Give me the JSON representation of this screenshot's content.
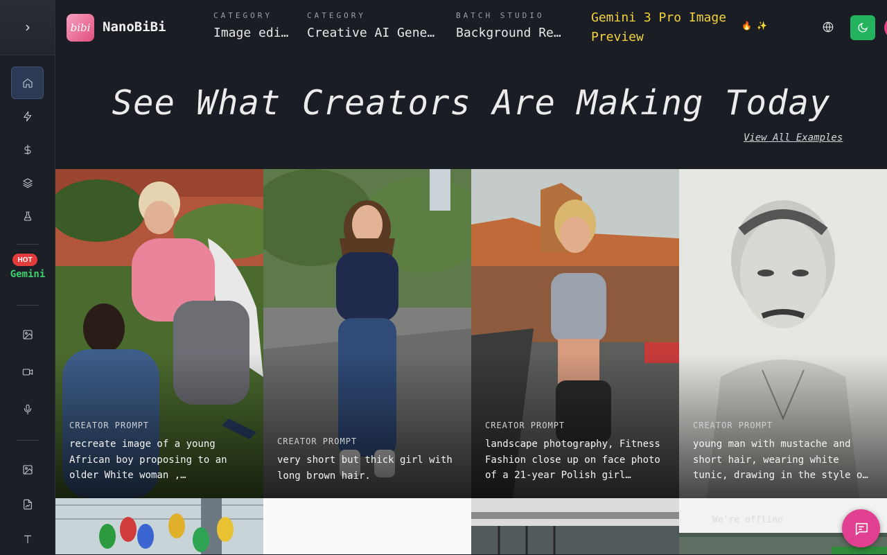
{
  "app": {
    "brand": "NanoBiBi",
    "logo_text": "bibi"
  },
  "sidebar": {
    "items": [
      {
        "icon": "home-icon"
      },
      {
        "icon": "lightning-icon"
      },
      {
        "icon": "dollar-icon"
      },
      {
        "icon": "layers-icon"
      },
      {
        "icon": "flask-icon"
      },
      {
        "icon": "image-icon"
      },
      {
        "icon": "video-icon"
      },
      {
        "icon": "microphone-icon"
      },
      {
        "icon": "image-edit-icon"
      },
      {
        "icon": "file-image-icon"
      },
      {
        "icon": "text-icon"
      }
    ],
    "hot_badge": "HOT",
    "gemini_label": "Gemini"
  },
  "header": {
    "nav": [
      {
        "caption": "CATEGORY",
        "value": "Image editing"
      },
      {
        "caption": "CATEGORY",
        "value": "Creative AI Generation"
      },
      {
        "caption": "BATCH STUDIO",
        "value": "Background Remover"
      }
    ],
    "model_name": "Gemini 3 Pro Image Preview",
    "model_emoji": "🔥 ✨"
  },
  "hero": {
    "title": "See What Creators Are Making Today",
    "view_all": "View All Examples"
  },
  "gallery": {
    "caption": "CREATOR PROMPT",
    "cards": [
      {
        "prompt": "recreate image of a young African boy proposing to an older White woman ,…"
      },
      {
        "prompt": "very short but thick girl with long brown hair."
      },
      {
        "prompt": "landscape photography, Fitness Fashion close up on face photo of a 21-year Polish girl…"
      },
      {
        "prompt": "young man with mustache and short hair, wearing white tunic, drawing in the style o…"
      }
    ]
  },
  "chat": {
    "offline_text": "We're offline"
  },
  "colors": {
    "accent_green": "#23b35e",
    "gemini_yellow": "#f3d23c",
    "hot_red": "#e23b3b",
    "chat_pink": "#e0408f"
  }
}
